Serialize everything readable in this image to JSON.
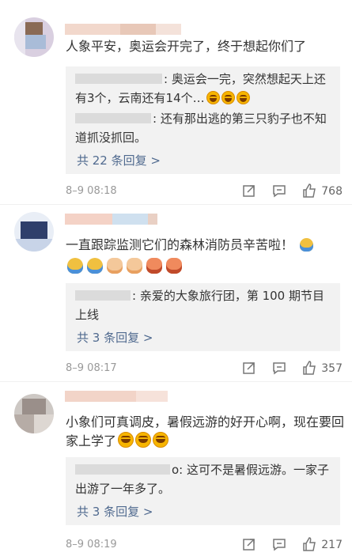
{
  "comments": [
    {
      "text": "人象平安，奥运会开完了，终于想起你们了",
      "replies": [
        {
          "text": ": 奥运会一完，突然想起天上还有3个，云南还有14个…",
          "emoji": [
            "laugh-emoji",
            "laugh-emoji",
            "laugh-emoji"
          ]
        },
        {
          "text": ": 还有那出逃的第三只豹子也不知道抓没抓回。"
        }
      ],
      "more": "共 22 条回复 >",
      "time": "8–9 08:18",
      "likes": "768"
    },
    {
      "text": "一直跟踪监测它们的森林消防员辛苦啦！",
      "emoji_row": [
        "worker-emoji",
        "worker-emoji",
        "clap-emoji",
        "clap-emoji",
        "bow-emoji",
        "bow-emoji"
      ],
      "replies": [
        {
          "text": ": 亲爱的大象旅行团，第 100 期节目上线"
        }
      ],
      "more": "共 3 条回复 >",
      "time": "8–9 08:17",
      "likes": "357"
    },
    {
      "text": "小象们可真调皮，暑假远游的好开心啊，现在要回家上学了",
      "replies": [
        {
          "text": "o: 这可不是暑假远游。一家子出游了一年多了。"
        }
      ],
      "more": "共 3 条回复 >",
      "time": "8–9 08:19",
      "likes": "217"
    }
  ],
  "colors": {
    "link": "#506a8f",
    "reply_bg": "#f2f2f2",
    "meta": "#999999"
  },
  "icons": {
    "share": "share-icon",
    "comment": "comment-icon",
    "like": "thumb-up-icon"
  }
}
